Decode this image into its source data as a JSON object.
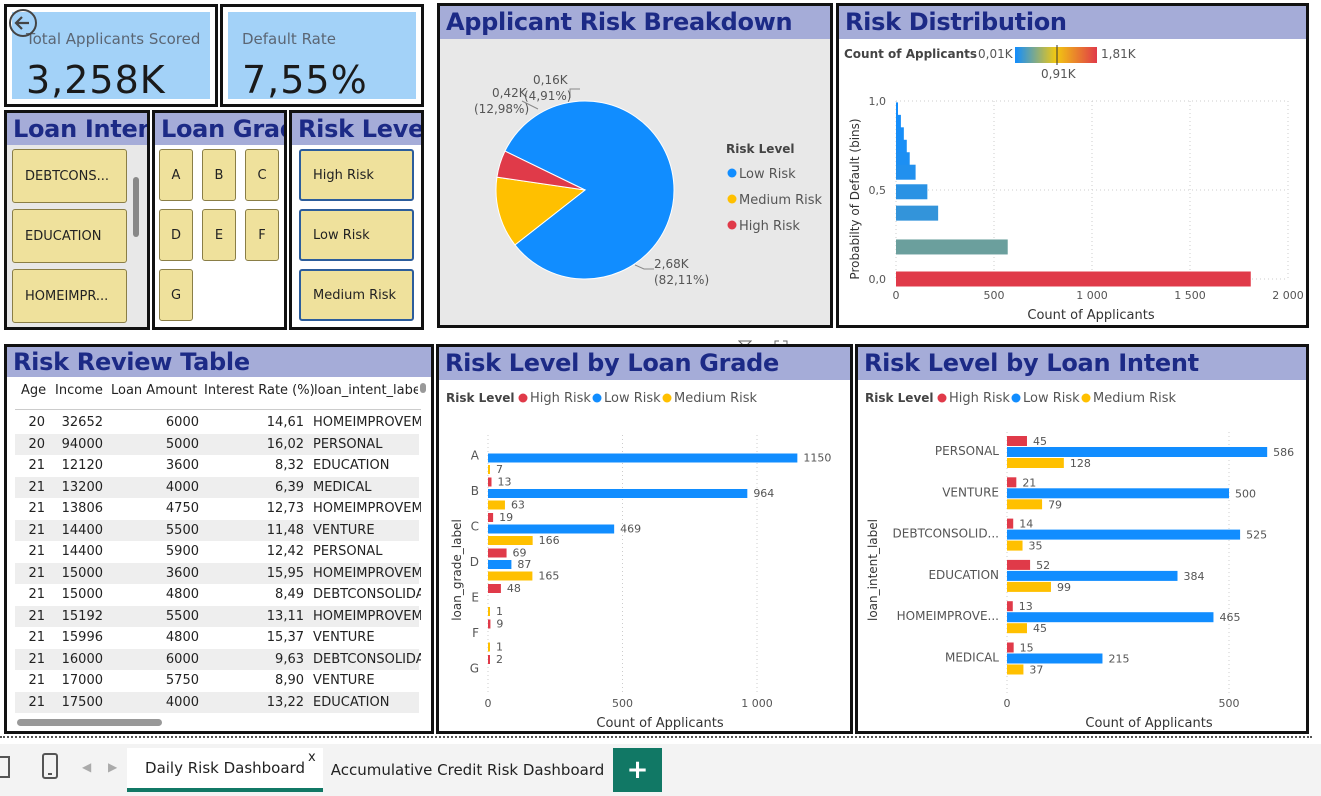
{
  "kpis": {
    "applicants_label": "Total Applicants Scored",
    "applicants_value": "3,258K",
    "default_label": "Default Rate",
    "default_value": "7,55%"
  },
  "slicers": {
    "intent_title": "Loan Intent",
    "intent_items": [
      "DEBTCONS...",
      "EDUCATION",
      "HOMEIMPR..."
    ],
    "grade_title": "Loan Grade",
    "grade_items": [
      "A",
      "B",
      "C",
      "D",
      "E",
      "F",
      "G"
    ],
    "risk_title": "Risk Level",
    "risk_items": [
      "High Risk",
      "Low Risk",
      "Medium Risk"
    ]
  },
  "pie": {
    "title": "Applicant Risk Breakdown",
    "legend_title": "Risk Level",
    "colors": {
      "low": "#118dff",
      "medium": "#ffc000",
      "high": "#e03a49"
    },
    "labels": {
      "low_value": "2,68K",
      "low_pct": "(82,11%)",
      "medium_value": "0,42K",
      "medium_pct": "(12,98%)",
      "high_value": "0,16K",
      "high_pct": "(4,91%)"
    }
  },
  "distribution": {
    "title": "Risk Distribution",
    "gradient_title": "Count of Applicants",
    "gradient_min": "0,01K",
    "gradient_mid": "0,91K",
    "gradient_max": "1,81K",
    "ylabel": "Probabilty of Default (bins)",
    "xlabel": "Count of Applicants",
    "y_ticks": [
      "1,0",
      "0,5",
      "0,0"
    ],
    "x_ticks": [
      "0",
      "500",
      "1 000",
      "1 500",
      "2 000"
    ]
  },
  "table": {
    "title": "Risk Review Table",
    "headers": [
      "Age",
      "Income",
      "Loan Amount",
      "Interest Rate (%)",
      "loan_intent_label"
    ],
    "rows": [
      [
        "20",
        "32652",
        "6000",
        "14,61",
        "HOMEIMPROVEM"
      ],
      [
        "20",
        "94000",
        "5000",
        "16,02",
        "PERSONAL"
      ],
      [
        "21",
        "12120",
        "3600",
        "8,32",
        "EDUCATION"
      ],
      [
        "21",
        "13200",
        "4000",
        "6,39",
        "MEDICAL"
      ],
      [
        "21",
        "13806",
        "4750",
        "12,73",
        "HOMEIMPROVEM"
      ],
      [
        "21",
        "14400",
        "5500",
        "11,48",
        "VENTURE"
      ],
      [
        "21",
        "14400",
        "5900",
        "12,42",
        "PERSONAL"
      ],
      [
        "21",
        "15000",
        "3600",
        "15,95",
        "HOMEIMPROVEM"
      ],
      [
        "21",
        "15000",
        "4800",
        "8,49",
        "DEBTCONSOLIDAT"
      ],
      [
        "21",
        "15192",
        "5500",
        "13,11",
        "HOMEIMPROVEM"
      ],
      [
        "21",
        "15996",
        "4800",
        "15,37",
        "VENTURE"
      ],
      [
        "21",
        "16000",
        "6000",
        "9,63",
        "DEBTCONSOLIDAT"
      ],
      [
        "21",
        "17000",
        "5750",
        "8,90",
        "VENTURE"
      ],
      [
        "21",
        "17500",
        "4000",
        "13,22",
        "EDUCATION"
      ]
    ]
  },
  "grade_chart": {
    "title": "Risk Level by Loan Grade",
    "legend_title": "Risk Level",
    "legend": [
      "High Risk",
      "Low Risk",
      "Medium Risk"
    ],
    "ylabel": "loan_grade_label",
    "xlabel": "Count of Applicants",
    "x_ticks": [
      "0",
      "500",
      "1 000"
    ]
  },
  "intent_chart": {
    "title": "Risk Level by Loan Intent",
    "legend_title": "Risk Level",
    "legend": [
      "High Risk",
      "Low Risk",
      "Medium Risk"
    ],
    "ylabel": "loan_intent_label",
    "xlabel": "Count of Applicants",
    "x_ticks": [
      "0",
      "500"
    ]
  },
  "tabs": {
    "active": "Daily Risk Dashboard",
    "close": "x",
    "other": "Accumulative Credit Risk Dashboard",
    "add": "+"
  },
  "chart_data": [
    {
      "type": "pie",
      "title": "Applicant Risk Breakdown",
      "legend_title": "Risk Level",
      "categories": [
        "Low Risk",
        "Medium Risk",
        "High Risk"
      ],
      "values": [
        2.68,
        0.42,
        0.16
      ],
      "percent": [
        82.11,
        12.98,
        4.91
      ],
      "unit": "K"
    },
    {
      "type": "bar",
      "orientation": "horizontal",
      "title": "Risk Distribution",
      "xlabel": "Count of Applicants",
      "ylabel": "Probabilty of Default (bins)",
      "ylim": [
        0,
        1
      ],
      "xlim": [
        0,
        2000
      ],
      "bins": [
        0.95,
        0.88,
        0.81,
        0.74,
        0.67,
        0.6,
        0.49,
        0.37,
        0.18,
        0.0
      ],
      "values": [
        10,
        25,
        40,
        55,
        70,
        100,
        160,
        215,
        570,
        1810
      ]
    },
    {
      "type": "bar",
      "orientation": "horizontal",
      "title": "Risk Level by Loan Grade",
      "xlabel": "Count of Applicants",
      "ylabel": "loan_grade_label",
      "categories": [
        "A",
        "B",
        "C",
        "D",
        "E",
        "F",
        "G"
      ],
      "series": [
        {
          "name": "High Risk",
          "color": "#e03a49",
          "values": [
            null,
            13,
            19,
            69,
            48,
            9,
            2
          ]
        },
        {
          "name": "Low Risk",
          "color": "#118dff",
          "values": [
            1150,
            964,
            469,
            87,
            null,
            null,
            null
          ]
        },
        {
          "name": "Medium Risk",
          "color": "#ffc000",
          "values": [
            7,
            63,
            166,
            165,
            1,
            1,
            null
          ]
        }
      ],
      "xlim": [
        0,
        1300
      ]
    },
    {
      "type": "bar",
      "orientation": "horizontal",
      "title": "Risk Level by Loan Intent",
      "xlabel": "Count of Applicants",
      "ylabel": "loan_intent_label",
      "categories": [
        "PERSONAL",
        "VENTURE",
        "DEBTCONSOLID...",
        "EDUCATION",
        "HOMEIMPROVE...",
        "MEDICAL"
      ],
      "series": [
        {
          "name": "High Risk",
          "color": "#e03a49",
          "values": [
            45,
            21,
            14,
            52,
            13,
            15
          ]
        },
        {
          "name": "Low Risk",
          "color": "#118dff",
          "values": [
            586,
            500,
            525,
            384,
            465,
            215
          ]
        },
        {
          "name": "Medium Risk",
          "color": "#ffc000",
          "values": [
            128,
            79,
            35,
            99,
            45,
            37
          ]
        }
      ],
      "xlim": [
        0,
        650
      ]
    }
  ]
}
